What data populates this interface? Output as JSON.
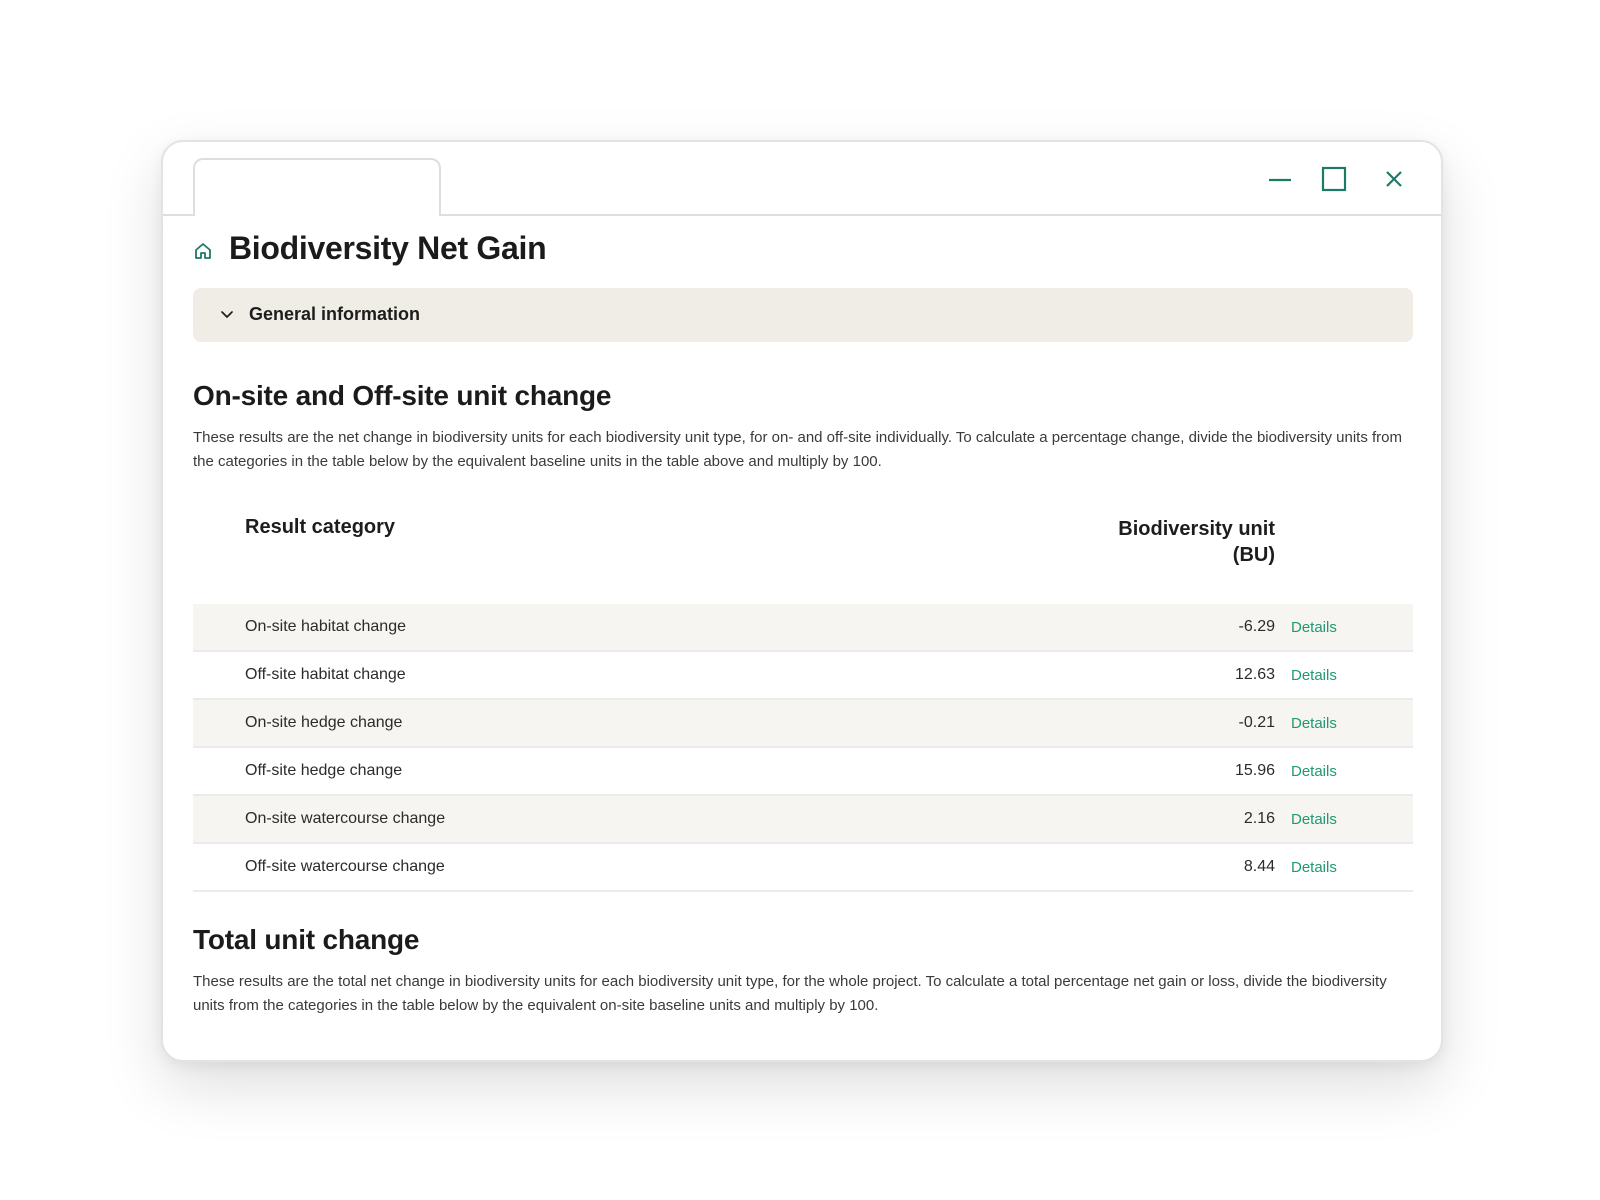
{
  "window": {
    "controls": {
      "minimize_icon": "minimize-icon",
      "maximize_icon": "maximize-icon",
      "close_icon": "close-icon",
      "accent_color": "#1d7a64"
    }
  },
  "page": {
    "home_icon": "home-icon",
    "title": "Biodiversity Net Gain"
  },
  "accordion": {
    "icon": "chevron-down-icon",
    "label": "General information",
    "background": "#f0ede6"
  },
  "section_unit_change": {
    "title": "On-site and Off-site unit change",
    "description": "These results are the net change in biodiversity units for each biodiversity unit type, for on- and off-site individually. To calculate a percentage change, divide the biodiversity units from the categories in the table below by the equivalent baseline units in the table above and multiply by 100.",
    "table": {
      "headers": {
        "category": "Result category",
        "unit": "Biodiversity unit (BU)"
      },
      "rows": [
        {
          "category": "On-site habitat change",
          "value": "-6.29",
          "link": "Details"
        },
        {
          "category": "Off-site habitat change",
          "value": "12.63",
          "link": "Details"
        },
        {
          "category": "On-site hedge change",
          "value": "-0.21",
          "link": "Details"
        },
        {
          "category": "Off-site hedge change",
          "value": "15.96",
          "link": "Details"
        },
        {
          "category": "On-site watercourse change",
          "value": "2.16",
          "link": "Details"
        },
        {
          "category": "Off-site watercourse change",
          "value": "8.44",
          "link": "Details"
        }
      ],
      "link_color": "#1d9a72",
      "alt_row_color": "#f6f5f1"
    }
  },
  "section_total": {
    "title": "Total unit change",
    "description": "These results are the total net change in biodiversity units for each biodiversity unit type, for the whole project. To calculate a total percentage net gain or loss, divide the biodiversity units from the categories in the table below by the equivalent on-site baseline units and multiply by 100."
  }
}
